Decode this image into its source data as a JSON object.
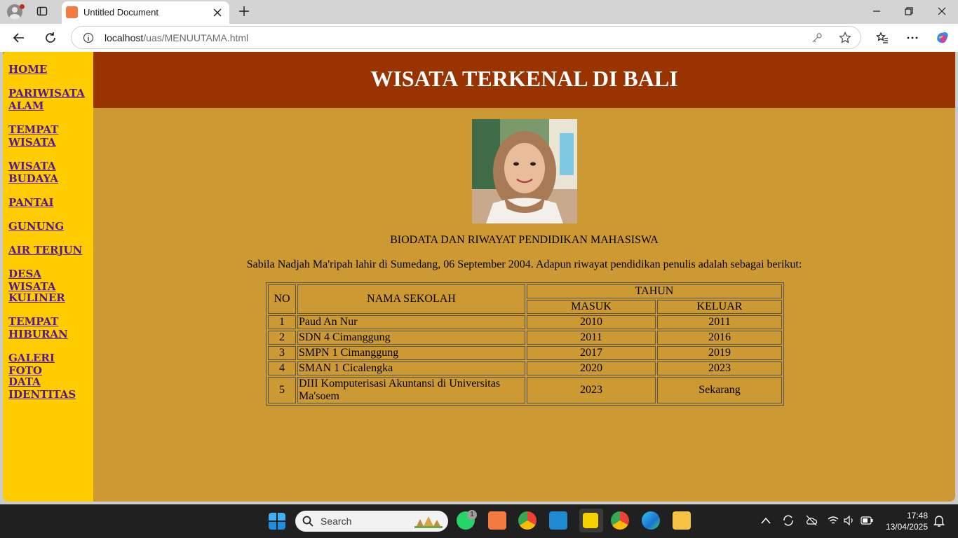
{
  "browser": {
    "tab_title": "Untitled Document",
    "url_host": "localhost",
    "url_path": "/uas/MENUUTAMA.html"
  },
  "page": {
    "heading": "WISATA TERKENAL DI BALI",
    "nav": [
      {
        "label": "HOME"
      },
      {
        "label": "PARIWISATA ALAM"
      },
      {
        "label": "TEMPAT WISATA"
      },
      {
        "label": "WISATA BUDAYA"
      },
      {
        "label": "PANTAI"
      },
      {
        "label": "GUNUNG"
      },
      {
        "label": "AIR TERJUN"
      },
      {
        "label": "DESA WISATA"
      },
      {
        "label": "KULINER"
      },
      {
        "label": "TEMPAT HIBURAN"
      },
      {
        "label": "GALERI FOTO"
      },
      {
        "label": "DATA IDENTITAS"
      }
    ],
    "bio_title": "BIODATA DAN RIWAYAT PENDIDIKAN MAHASISWA",
    "bio_text": "Sabila Nadjah Ma'ripah lahir di Sumedang, 06 September 2004. Adapun riwayat pendidikan penulis adalah sebagai berikut:",
    "table": {
      "headers": {
        "no": "NO",
        "school": "NAMA SEKOLAH",
        "year": "TAHUN",
        "in": "MASUK",
        "out": "KELUAR"
      },
      "rows": [
        {
          "no": "1",
          "school": "Paud An Nur",
          "in": "2010",
          "out": "2011"
        },
        {
          "no": "2",
          "school": "SDN 4 Cimanggung",
          "in": "2011",
          "out": "2016"
        },
        {
          "no": "3",
          "school": "SMPN 1 Cimanggung",
          "in": "2017",
          "out": "2019"
        },
        {
          "no": "4",
          "school": "SMAN 1 Cicalengka",
          "in": "2020",
          "out": "2023"
        },
        {
          "no": "5",
          "school": "DIII Komputerisasi Akuntansi di Universitas Ma'soem",
          "in": "2023",
          "out": "Sekarang"
        }
      ]
    }
  },
  "taskbar": {
    "search_placeholder": "Search",
    "whatsapp_badge": "1",
    "time": "17:48",
    "date": "13/04/2025"
  },
  "colors": {
    "sidebar": "#ffcc00",
    "header": "#993300",
    "content_bg": "#cc9933",
    "link": "#551a8b"
  }
}
